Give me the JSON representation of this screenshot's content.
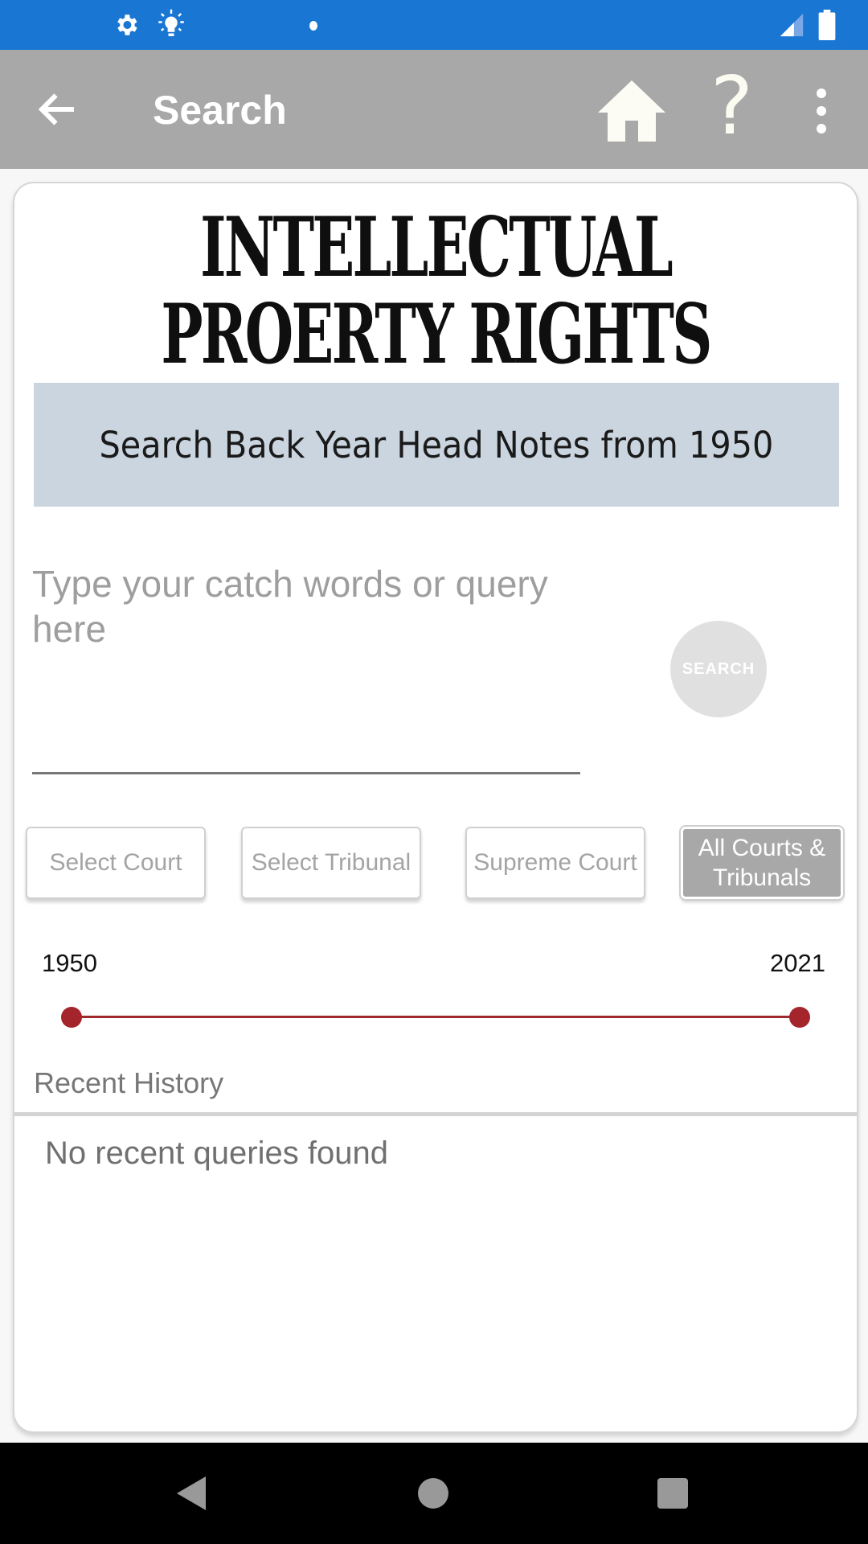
{
  "status_bar": {
    "icons": [
      "settings-icon",
      "brightness-icon",
      "notification-dot-icon",
      "signal-icon",
      "battery-icon"
    ]
  },
  "app_bar": {
    "title": "Search",
    "back_icon": "arrow-left-icon",
    "actions": [
      "home-icon",
      "help-icon",
      "more-vert-icon"
    ],
    "help_glyph": "?"
  },
  "brand": {
    "line1": "INTELLECTUAL",
    "line2": "PROERTY RIGHTS"
  },
  "banner": {
    "text": "Search Back Year Head Notes from 1950"
  },
  "search": {
    "value": "",
    "placeholder": "Type your catch words or query here",
    "button_label": "SEARCH"
  },
  "filters": [
    {
      "label": "Select Court",
      "active": false
    },
    {
      "label": "Select Tribunal",
      "active": false
    },
    {
      "label": "Supreme Court",
      "active": false
    },
    {
      "label": "All Courts & Tribunals",
      "active": true
    }
  ],
  "year_range": {
    "min_label": "1950",
    "max_label": "2021",
    "min": 1950,
    "max": 2021,
    "selected_start": 1950,
    "selected_end": 2021
  },
  "recent_history": {
    "title": "Recent History",
    "empty_text": "No recent queries found"
  },
  "colors": {
    "status_bar": "#1976d2",
    "app_bar": "#a8a8a8",
    "banner": "#cad5df",
    "slider": "#a4262c"
  },
  "nav_bar": {
    "buttons": [
      "back-nav-icon",
      "home-nav-icon",
      "recents-nav-icon"
    ]
  }
}
